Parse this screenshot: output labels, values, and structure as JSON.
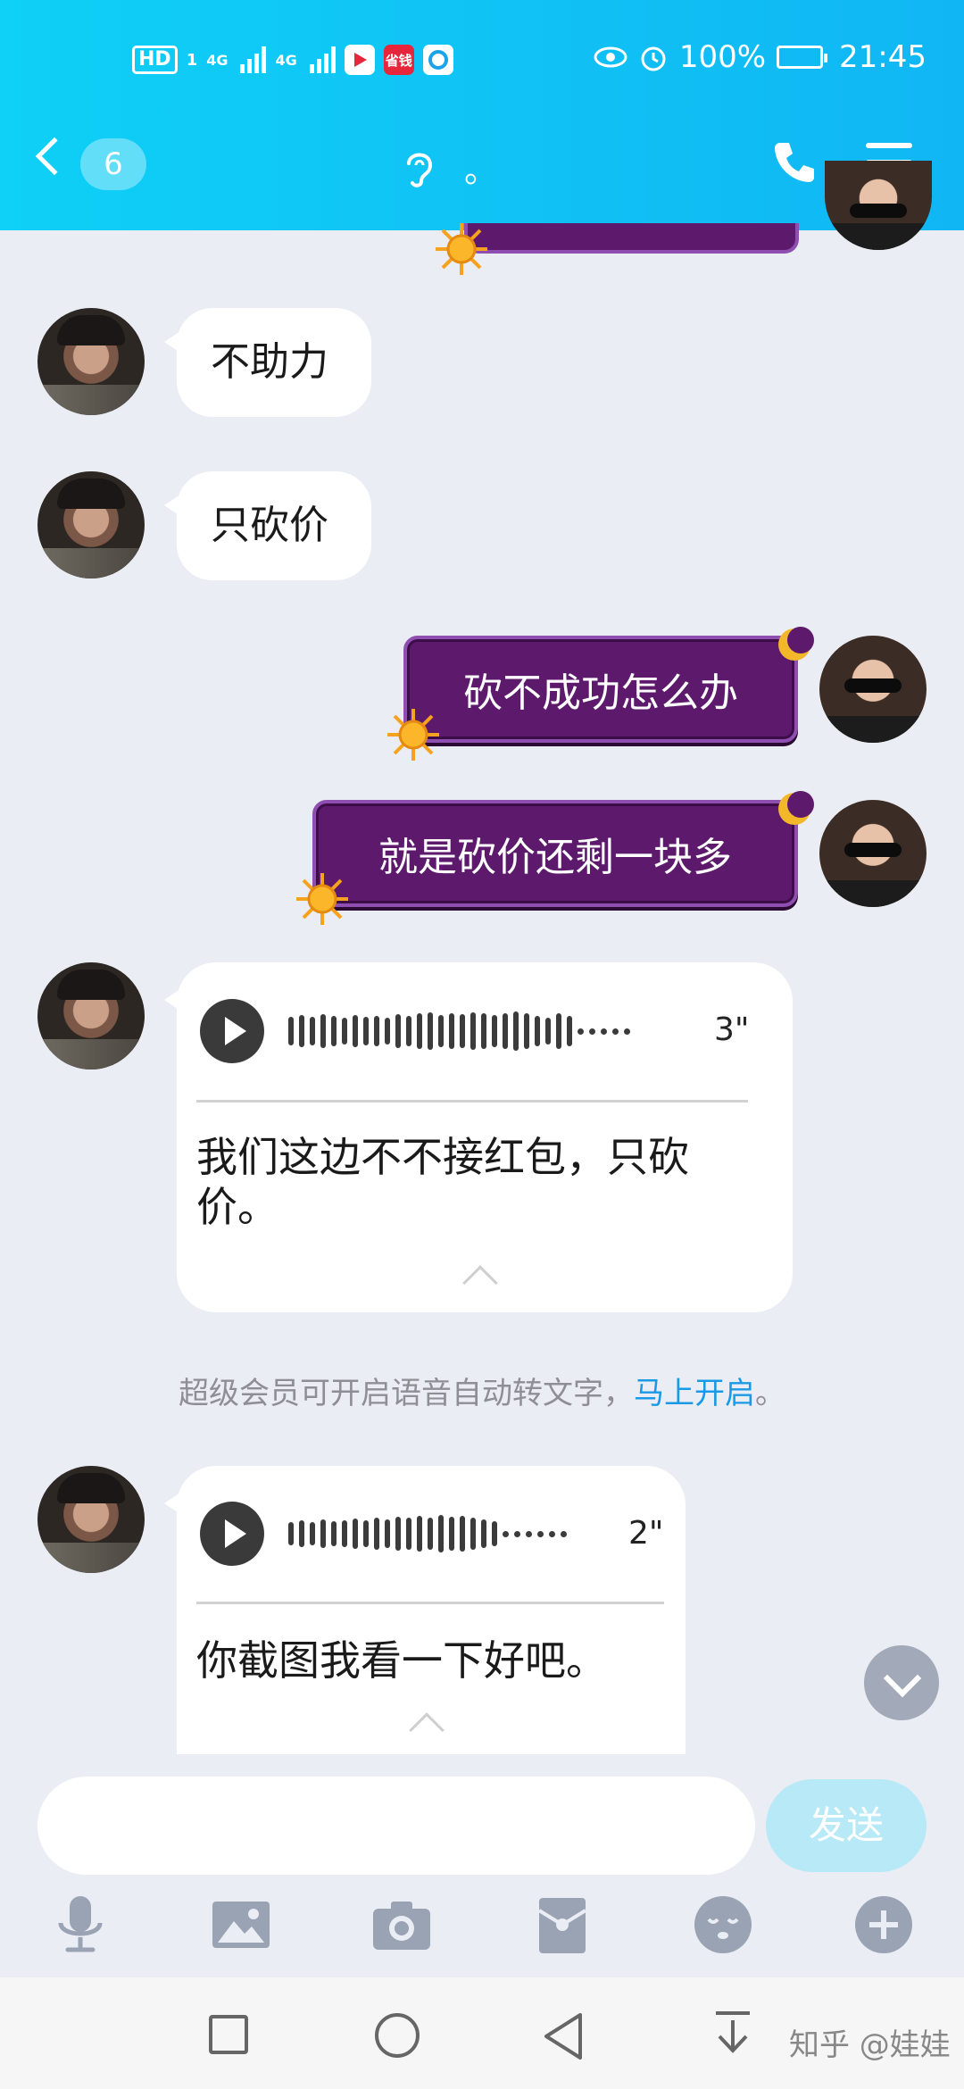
{
  "status_bar": {
    "hd": "HD",
    "sim": "1",
    "net1": "4G",
    "net2": "4G",
    "app2": "省钱",
    "battery": "100%",
    "time": "21:45"
  },
  "header": {
    "unread_count": "6",
    "title_suffix": "。"
  },
  "messages": {
    "m1": "不助力",
    "m2": "只砍价",
    "m3": "砍不成功怎么办",
    "m4": "就是砍价还剩一块多",
    "voice1": {
      "duration": "3\"",
      "text": "我们这边不不接红包，只砍价。"
    },
    "voice2": {
      "duration": "2\"",
      "text": "你截图我看一下好吧。"
    }
  },
  "system_note": {
    "text": "超级会员可开启语音自动转文字，",
    "link": "马上开启",
    "end": "。"
  },
  "input": {
    "value": "",
    "placeholder": "",
    "send_label": "发送"
  },
  "watermark": "知乎 @娃娃",
  "colors": {
    "header": "#0fd0f6",
    "bubble_purple": "#5d1a6d",
    "link": "#1a9ae6"
  }
}
